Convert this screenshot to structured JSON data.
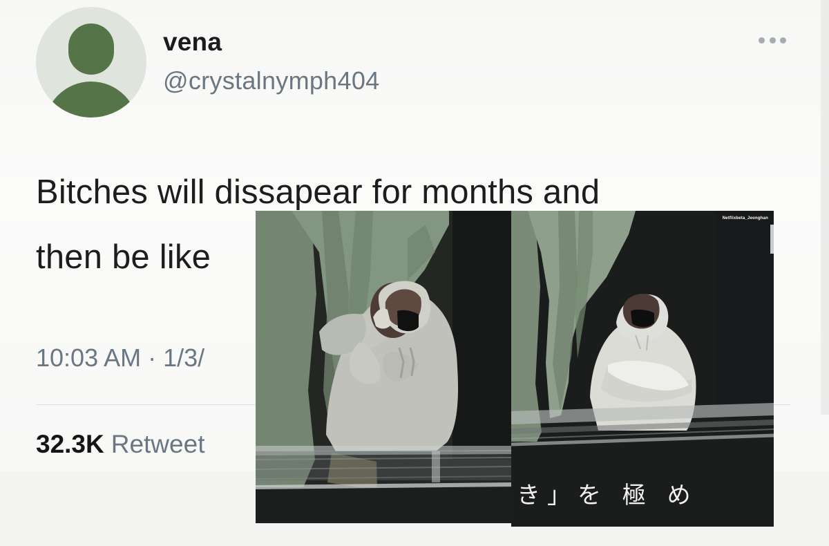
{
  "user": {
    "display_name": "vena",
    "handle": "@crystalnymph404",
    "avatar_icon": "default-avatar-icon"
  },
  "tweet": {
    "line1": "Bitches will dissapear for months and",
    "line2": "then be like",
    "timestamp": "10:03 AM · 1/3/"
  },
  "stats": {
    "retweet_count": "32.3K",
    "retweet_label": "Retweet"
  },
  "photo": {
    "watermark": "Netflixbeta_Jeonghan",
    "sign_text": "き」を 極 め"
  },
  "colors": {
    "avatar_bg": "#dfe5dc",
    "avatar_fg": "#557548",
    "secondary_text": "#6a7682"
  }
}
